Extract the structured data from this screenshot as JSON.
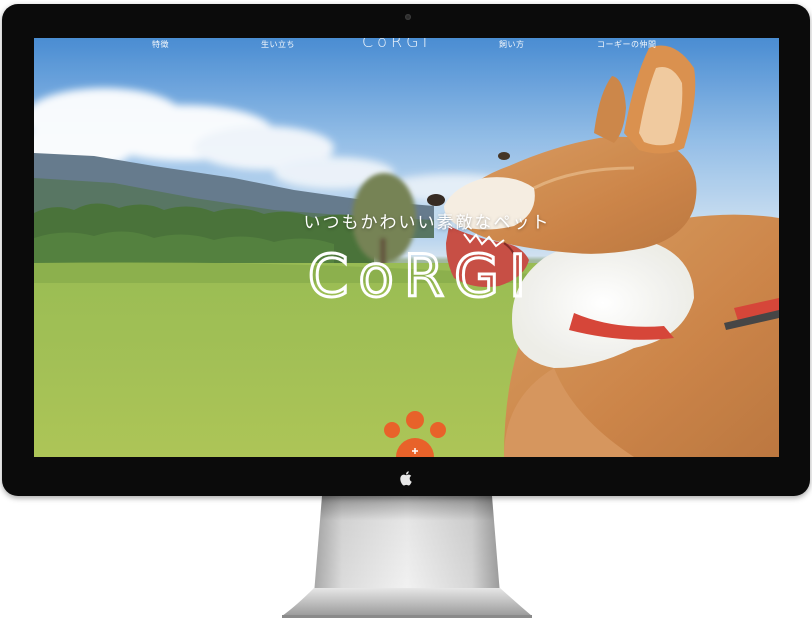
{
  "nav": {
    "items": [
      {
        "label": "特徴"
      },
      {
        "label": "生い立ち"
      },
      {
        "label": "飼い方"
      },
      {
        "label": "コーギーの仲間"
      }
    ],
    "logo": "CoRGI"
  },
  "hero": {
    "tagline": "いつもかわいい素敵なペット",
    "title": "CoRGI"
  },
  "colors": {
    "accent": "#e8622a",
    "bezel": "#0b0b0b",
    "sky": "#6aa4dc",
    "grass": "#9bbd45"
  },
  "icons": {
    "apple": "apple-logo-icon",
    "paw": "paw-icon"
  }
}
